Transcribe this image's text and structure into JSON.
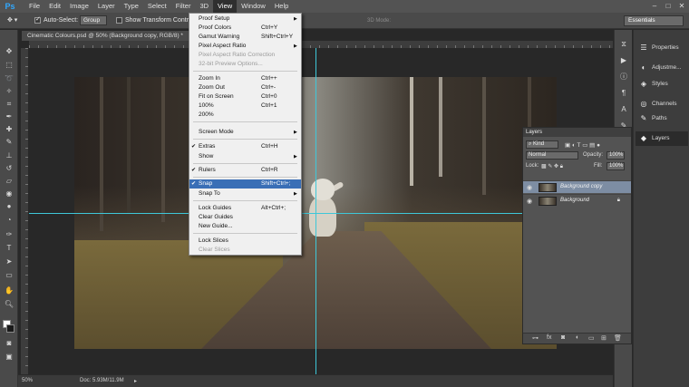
{
  "app": {
    "logo": "Ps",
    "colors": {
      "accent": "#31a8ff",
      "guide": "#3ec7d8",
      "highlight": "#3a6fb6"
    }
  },
  "menubar": {
    "items": [
      "File",
      "Edit",
      "Image",
      "Layer",
      "Type",
      "Select",
      "Filter",
      "3D",
      "View",
      "Window",
      "Help"
    ],
    "active": "View",
    "window_controls": [
      "–",
      "□",
      "✕"
    ]
  },
  "options_bar": {
    "auto_select_label": "Auto-Select:",
    "auto_select_value": "Group",
    "show_transform_label": "Show Transform Controls",
    "mode_label": "3D Mode:",
    "workspace": "Essentials"
  },
  "document_tab": {
    "title": "Cinematic Colours.psd @ 50% (Background copy, RGB/8) *",
    "close": "×"
  },
  "view_menu": {
    "items": [
      {
        "label": "Proof Setup",
        "shortcut": "",
        "submenu": true,
        "checked": false,
        "disabled": false
      },
      {
        "label": "Proof Colors",
        "shortcut": "Ctrl+Y",
        "submenu": false,
        "checked": false,
        "disabled": false
      },
      {
        "label": "Gamut Warning",
        "shortcut": "Shift+Ctrl+Y",
        "submenu": false,
        "checked": false,
        "disabled": false
      },
      {
        "label": "Pixel Aspect Ratio",
        "shortcut": "",
        "submenu": true,
        "checked": false,
        "disabled": false
      },
      {
        "label": "Pixel Aspect Ratio Correction",
        "shortcut": "",
        "submenu": false,
        "checked": false,
        "disabled": true
      },
      {
        "label": "32-bit Preview Options...",
        "shortcut": "",
        "submenu": false,
        "checked": false,
        "disabled": true
      },
      {
        "label": "Zoom In",
        "shortcut": "Ctrl++",
        "submenu": false,
        "checked": false,
        "disabled": false
      },
      {
        "label": "Zoom Out",
        "shortcut": "Ctrl+-",
        "submenu": false,
        "checked": false,
        "disabled": false
      },
      {
        "label": "Fit on Screen",
        "shortcut": "Ctrl+0",
        "submenu": false,
        "checked": false,
        "disabled": false
      },
      {
        "label": "100%",
        "shortcut": "Ctrl+1",
        "submenu": false,
        "checked": false,
        "disabled": false
      },
      {
        "label": "200%",
        "shortcut": "",
        "submenu": false,
        "checked": false,
        "disabled": false
      },
      {
        "label": "Screen Mode",
        "shortcut": "",
        "submenu": true,
        "checked": false,
        "disabled": false
      },
      {
        "label": "Extras",
        "shortcut": "Ctrl+H",
        "submenu": false,
        "checked": true,
        "disabled": false
      },
      {
        "label": "Show",
        "shortcut": "",
        "submenu": true,
        "checked": false,
        "disabled": false
      },
      {
        "label": "Rulers",
        "shortcut": "Ctrl+R",
        "submenu": false,
        "checked": true,
        "disabled": false
      },
      {
        "label": "Snap",
        "shortcut": "Shift+Ctrl+;",
        "submenu": false,
        "checked": true,
        "disabled": false,
        "highlighted": true
      },
      {
        "label": "Snap To",
        "shortcut": "",
        "submenu": true,
        "checked": false,
        "disabled": false
      },
      {
        "label": "Lock Guides",
        "shortcut": "Alt+Ctrl+;",
        "submenu": false,
        "checked": false,
        "disabled": false
      },
      {
        "label": "Clear Guides",
        "shortcut": "",
        "submenu": false,
        "checked": false,
        "disabled": false
      },
      {
        "label": "New Guide...",
        "shortcut": "",
        "submenu": false,
        "checked": false,
        "disabled": false
      },
      {
        "label": "Lock Slices",
        "shortcut": "",
        "submenu": false,
        "checked": false,
        "disabled": false
      },
      {
        "label": "Clear Slices",
        "shortcut": "",
        "submenu": false,
        "checked": false,
        "disabled": true
      }
    ]
  },
  "dock": {
    "items": [
      {
        "label": "Properties",
        "icon": "properties-icon",
        "glyph": "☰"
      },
      {
        "label": "Adjustme...",
        "icon": "adjustments-icon",
        "glyph": "◐"
      },
      {
        "label": "Styles",
        "icon": "styles-icon",
        "glyph": "◈"
      },
      {
        "label": "Channels",
        "icon": "channels-icon",
        "glyph": "◎"
      },
      {
        "label": "Paths",
        "icon": "paths-icon",
        "glyph": "✎"
      },
      {
        "label": "Layers",
        "icon": "layers-icon",
        "glyph": "◆"
      }
    ]
  },
  "layers_panel": {
    "title": "Layers",
    "kind": "Kind",
    "blend_mode": "Normal",
    "opacity_label": "Opacity:",
    "opacity": "100%",
    "lock_label": "Lock:",
    "fill_label": "Fill:",
    "fill": "100%",
    "layers": [
      {
        "name": "Background copy",
        "selected": true,
        "locked": false
      },
      {
        "name": "Background",
        "selected": false,
        "locked": true
      }
    ]
  },
  "status": {
    "zoom": "50%",
    "doc": "Doc: 5.93M/11.9M"
  }
}
